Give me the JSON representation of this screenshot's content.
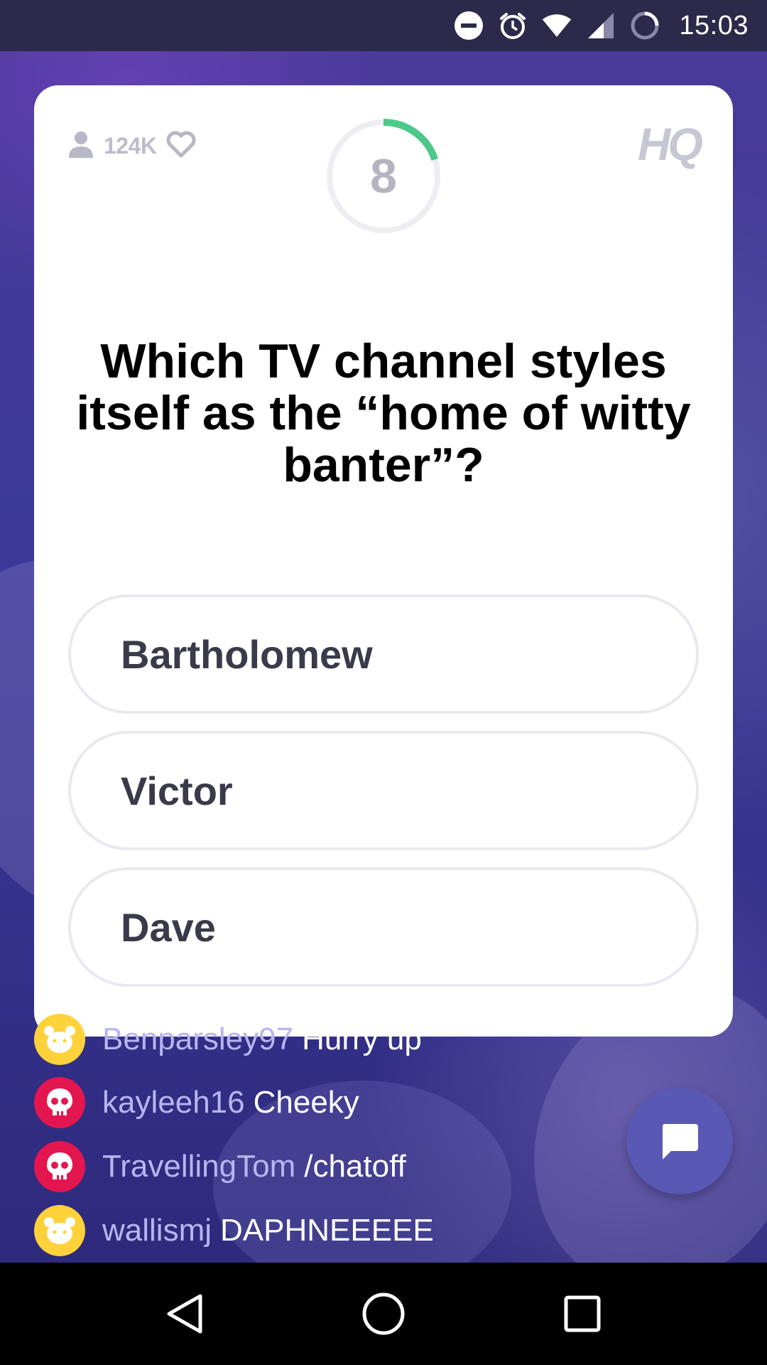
{
  "status_bar": {
    "time": "15:03",
    "icons": [
      "do-not-disturb-icon",
      "alarm-icon",
      "wifi-icon",
      "cell-signal-icon",
      "battery-charging-icon"
    ]
  },
  "card": {
    "viewer_count": "124K",
    "timer_value": "8",
    "timer_progress": 0.2,
    "logo": "HQ",
    "question": "Which TV channel styles itself as the “home of witty banter”?",
    "answers": [
      {
        "label": "Bartholomew"
      },
      {
        "label": "Victor"
      },
      {
        "label": "Dave"
      }
    ]
  },
  "chat": {
    "messages": [
      {
        "user": "Benparsley97",
        "text": "Hurry up",
        "avatar_color": "#ffd13a",
        "avatar_icon": "bear-icon"
      },
      {
        "user": "kayleeh16",
        "text": "Cheeky",
        "avatar_color": "#e4164f",
        "avatar_icon": "skull-icon"
      },
      {
        "user": "TravellingTom",
        "text": "/chatoff",
        "avatar_color": "#e4164f",
        "avatar_icon": "skull-icon"
      },
      {
        "user": "wallismj",
        "text": "DAPHNEEEEE",
        "avatar_color": "#ffd13a",
        "avatar_icon": "bear-icon"
      }
    ]
  },
  "colors": {
    "accent": "#4cc98a",
    "background": "#3d3a9a",
    "chat_fab": "#5a58b5"
  },
  "nav_bar": {
    "buttons": [
      "back-icon",
      "home-icon",
      "recents-icon"
    ]
  }
}
